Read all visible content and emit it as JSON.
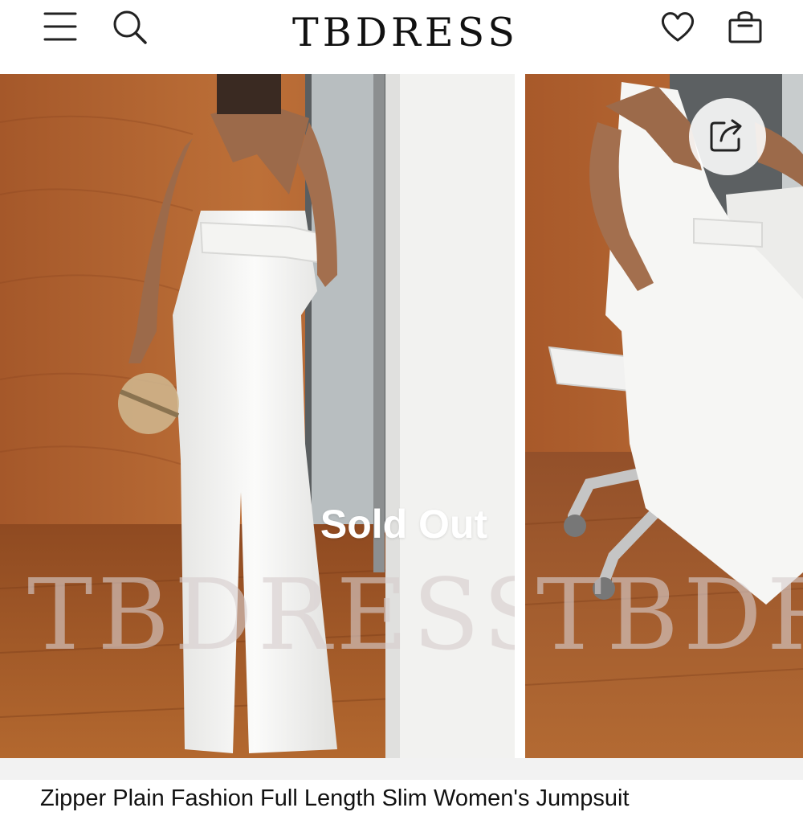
{
  "header": {
    "logo": "TBDRESS",
    "icons": {
      "menu": "hamburger-menu-icon",
      "search": "search-icon",
      "wishlist": "heart-icon",
      "bag": "shopping-bag-icon"
    }
  },
  "gallery": {
    "status_overlay": "Sold Out",
    "watermark_1": "TBDRESS",
    "watermark_2": "TBDRESS",
    "share_icon": "share-icon"
  },
  "product": {
    "title": "Zipper Plain Fashion Full Length Slim Women's Jumpsuit"
  },
  "colors": {
    "background": "#ffffff",
    "text": "#111111",
    "overlay_text": "#ffffff",
    "strip": "#f2f2f2"
  }
}
